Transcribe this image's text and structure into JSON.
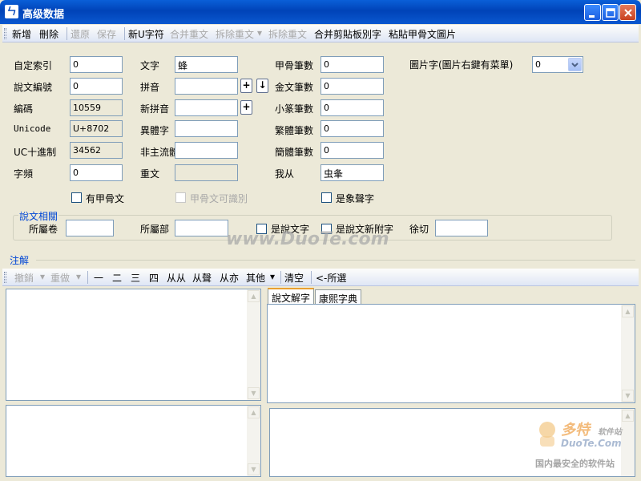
{
  "window": {
    "title": "高级数据",
    "icon": "app-logo-icon"
  },
  "toolbar": {
    "add": "新增",
    "delete": "刪除",
    "restore": "還原",
    "save": "保存",
    "new_u_char": "新U字符",
    "merge_dup": "合并重文",
    "split_dup": "拆除重文",
    "remove_dup": "拆除重文",
    "merge_clip_variant": "合并剪貼板別字",
    "paste_oracle_image": "粘貼甲骨文圖片"
  },
  "form": {
    "custom_index": {
      "label": "自定索引",
      "value": "0"
    },
    "shuowen_no": {
      "label": "說文編號",
      "value": "0"
    },
    "code": {
      "label": "編碼",
      "value": "10559"
    },
    "unicode": {
      "label": "Unicode",
      "value": "U+8702"
    },
    "uc_decimal": {
      "label": "UC十進制",
      "value": "34562"
    },
    "frequency": {
      "label": "字頻",
      "value": "0"
    },
    "character": {
      "label": "文字",
      "value": "蜂"
    },
    "pinyin": {
      "label": "拼音",
      "value": ""
    },
    "new_pinyin": {
      "label": "新拼音",
      "value": ""
    },
    "variant": {
      "label": "異體字",
      "value": ""
    },
    "non_main": {
      "label": "非主流體",
      "value": ""
    },
    "duplicate": {
      "label": "重文",
      "value": ""
    },
    "oracle_strokes": {
      "label": "甲骨筆數",
      "value": "0"
    },
    "bronze_strokes": {
      "label": "金文筆數",
      "value": "0"
    },
    "small_seal_strokes": {
      "label": "小篆筆數",
      "value": "0"
    },
    "trad_strokes": {
      "label": "繁體筆數",
      "value": "0"
    },
    "simp_strokes": {
      "label": "簡體筆數",
      "value": "0"
    },
    "from": {
      "label": "我从",
      "value": "虫夆"
    },
    "image_char": {
      "label": "圖片字(圖片右鍵有菜單)",
      "value": "0"
    },
    "has_oracle": "有甲骨文",
    "oracle_recognizable": "甲骨文可識別",
    "pictophonetic": "是象聲字",
    "plus_btn": "+",
    "down_btn": "↓"
  },
  "shuowen_group": {
    "title": "說文相關",
    "volume": {
      "label": "所屬卷",
      "value": ""
    },
    "radical": {
      "label": "所屬部",
      "value": ""
    },
    "is_shuowen": "是說文字",
    "is_shuowen_new": "是說文新附字",
    "fanqie": {
      "label": "徐切",
      "value": ""
    }
  },
  "notes": {
    "title": "注解",
    "toolbar": {
      "undo": "撤銷",
      "redo": "重做",
      "one": "一",
      "two": "二",
      "three": "三",
      "four": "四",
      "congcong": "从从",
      "congsheng": "从聲",
      "congyi": "从亦",
      "other": "其他",
      "clear": "清空",
      "select": "<-所選"
    },
    "tabs": [
      {
        "label": "說文解字"
      },
      {
        "label": "康熙字典"
      }
    ]
  },
  "watermarks": {
    "center": "www.DuoTe.com",
    "brand_cn": "多特",
    "brand_sub": "软件站",
    "brand_en": "DuoTe.Com",
    "slogan": "国内最安全的软件站"
  },
  "colors": {
    "titlebar": "#0043b8",
    "group_title": "#0046d5",
    "window_bg": "#ece9d8"
  }
}
